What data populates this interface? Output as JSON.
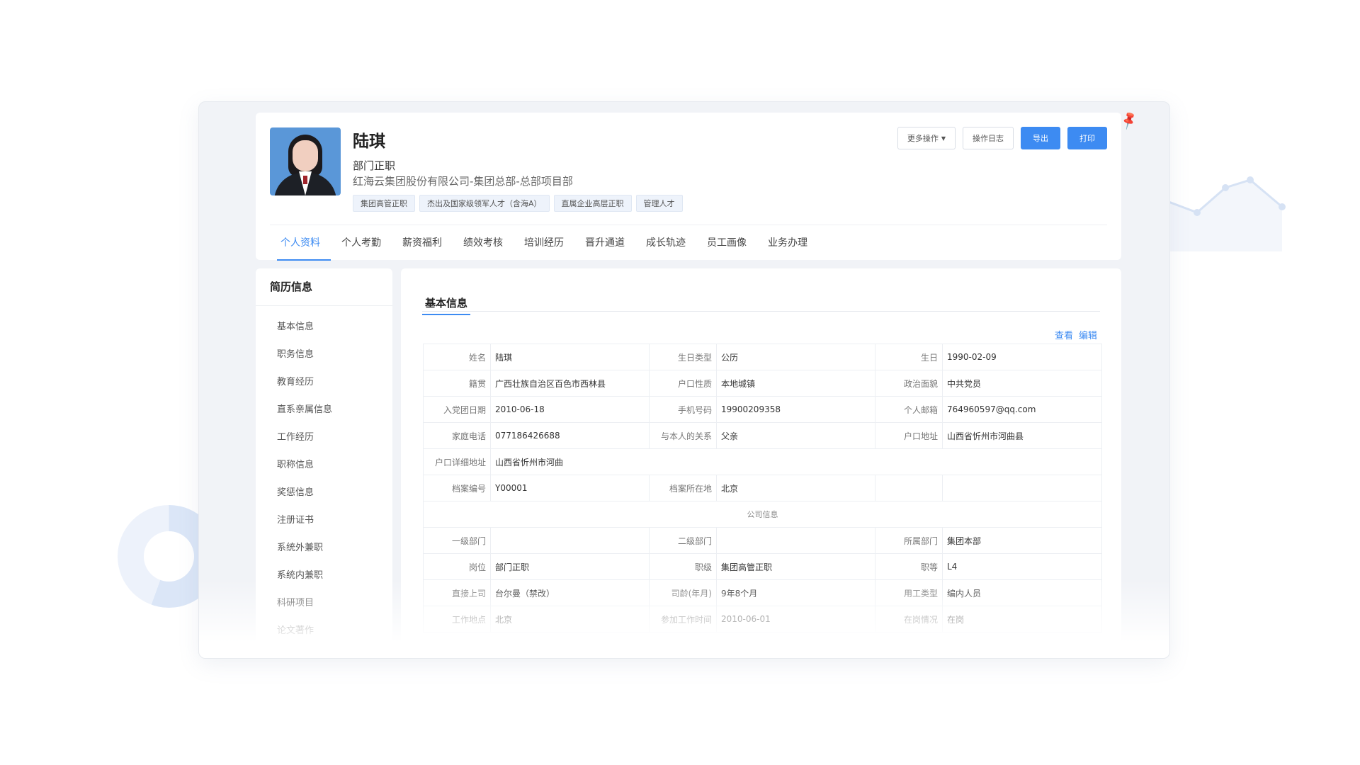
{
  "profile": {
    "name": "陆琪",
    "position": "部门正职",
    "organization": "红海云集团股份有限公司-集团总部-总部项目部",
    "tags": [
      "集团高管正职",
      "杰出及国家级领军人才（含海A）",
      "直属企业高层正职",
      "管理人才"
    ]
  },
  "actions": {
    "more": "更多操作",
    "log": "操作日志",
    "export": "导出",
    "print": "打印"
  },
  "tabs": [
    "个人资料",
    "个人考勤",
    "薪资福利",
    "绩效考核",
    "培训经历",
    "晋升通道",
    "成长轨迹",
    "员工画像",
    "业务办理"
  ],
  "sidebar": {
    "title": "简历信息",
    "items": [
      "基本信息",
      "职务信息",
      "教育经历",
      "直系亲属信息",
      "工作经历",
      "职称信息",
      "奖惩信息",
      "注册证书",
      "系统外兼职",
      "系统内兼职",
      "科研项目",
      "论文著作"
    ]
  },
  "section": {
    "title": "基本信息",
    "view_link": "查看",
    "edit_link": "编辑",
    "company_divider": "公司信息"
  },
  "basic_rows": [
    [
      "姓名",
      "陆琪",
      "生日类型",
      "公历",
      "生日",
      "1990-02-09"
    ],
    [
      "籍贯",
      "广西壮族自治区百色市西林县",
      "户口性质",
      "本地城镇",
      "政治面貌",
      "中共党员"
    ],
    [
      "入党团日期",
      "2010-06-18",
      "手机号码",
      "19900209358",
      "个人邮箱",
      "764960597@qq.com"
    ],
    [
      "家庭电话",
      "077186426688",
      "与本人的关系",
      "父亲",
      "户口地址",
      "山西省忻州市河曲县"
    ],
    [
      "户口详细地址",
      "山西省忻州市河曲",
      "",
      "",
      "",
      ""
    ],
    [
      "档案编号",
      "Y00001",
      "档案所在地",
      "北京",
      "",
      ""
    ]
  ],
  "company_rows": [
    [
      "一级部门",
      "",
      "二级部门",
      "",
      "所属部门",
      "集团本部"
    ],
    [
      "岗位",
      "部门正职",
      "职级",
      "集团高管正职",
      "职等",
      "L4"
    ],
    [
      "直接上司",
      "台尔曼（禁改）",
      "司龄(年月)",
      "9年8个月",
      "用工类型",
      "编内人员"
    ],
    [
      "工作地点",
      "北京",
      "参加工作时间",
      "2010-06-01",
      "在岗情况",
      "在岗"
    ]
  ],
  "icons": {
    "pin": "pin-icon",
    "caret": "chevron-down-icon"
  },
  "colors": {
    "accent": "#3d8bf2"
  }
}
